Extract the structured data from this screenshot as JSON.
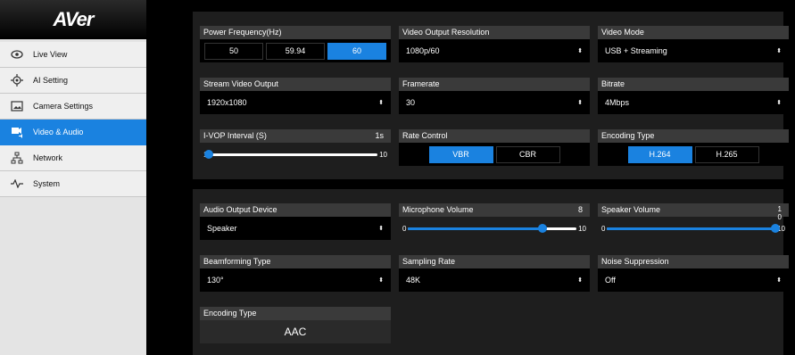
{
  "brand": {
    "logo": "AVer"
  },
  "sidebar": {
    "items": [
      {
        "label": "Live View",
        "icon": "eye-icon"
      },
      {
        "label": "AI Setting",
        "icon": "target-icon"
      },
      {
        "label": "Camera Settings",
        "icon": "image-icon"
      },
      {
        "label": "Video & Audio",
        "icon": "video-audio-icon",
        "active": true
      },
      {
        "label": "Network",
        "icon": "network-icon"
      },
      {
        "label": "System",
        "icon": "pulse-icon"
      }
    ]
  },
  "video": {
    "power_frequency": {
      "label": "Power Frequency(Hz)",
      "options": [
        "50",
        "59.94",
        "60"
      ],
      "selected": "60"
    },
    "video_output_resolution": {
      "label": "Video Output Resolution",
      "value": "1080p/60"
    },
    "video_mode": {
      "label": "Video Mode",
      "value": "USB + Streaming"
    },
    "stream_video_output": {
      "label": "Stream Video Output",
      "value": "1920x1080"
    },
    "framerate": {
      "label": "Framerate",
      "value": "30"
    },
    "bitrate": {
      "label": "Bitrate",
      "value": "4Mbps"
    },
    "ivop_interval": {
      "label": "I-VOP Interval (S)",
      "current": "1s",
      "min": "1",
      "max": "10",
      "value": 1
    },
    "rate_control": {
      "label": "Rate Control",
      "options": [
        "VBR",
        "CBR"
      ],
      "selected": "VBR"
    },
    "encoding_type": {
      "label": "Encoding Type",
      "options": [
        "H.264",
        "H.265"
      ],
      "selected": "H.264"
    }
  },
  "audio": {
    "audio_output_device": {
      "label": "Audio Output Device",
      "value": "Speaker"
    },
    "microphone_volume": {
      "label": "Microphone Volume",
      "current": "8",
      "min": "0",
      "max": "10",
      "value": 8
    },
    "speaker_volume": {
      "label": "Speaker Volume",
      "current_line1": "1",
      "current_line2": "0",
      "min": "0",
      "max": "10",
      "value": 10
    },
    "beamforming_type": {
      "label": "Beamforming Type",
      "value": "130°"
    },
    "sampling_rate": {
      "label": "Sampling Rate",
      "value": "48K"
    },
    "noise_suppression": {
      "label": "Noise Suppression",
      "value": "Off"
    },
    "encoding_type": {
      "label": "Encoding Type",
      "value": "AAC"
    }
  },
  "colors": {
    "accent": "#1a82e0",
    "panel": "#1e1e1e",
    "label_bg": "#3a3a3a"
  }
}
